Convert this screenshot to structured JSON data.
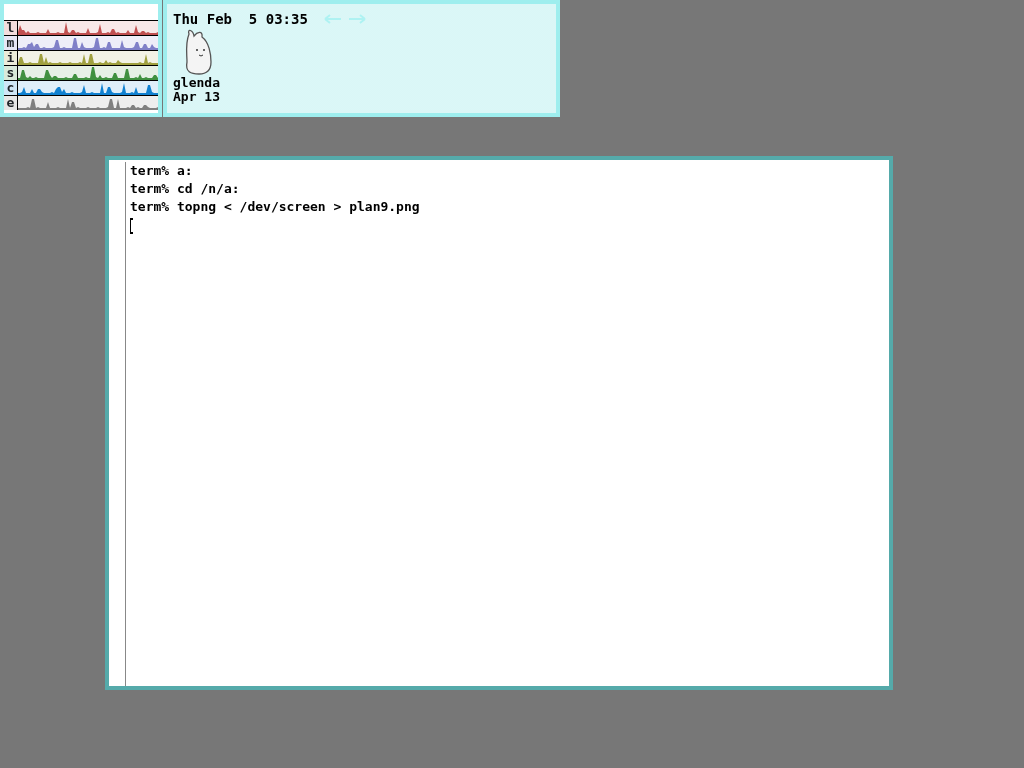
{
  "stats": [
    {
      "label": "l",
      "color": "#c05050"
    },
    {
      "label": "m",
      "color": "#8080c8"
    },
    {
      "label": "i",
      "color": "#a0a040"
    },
    {
      "label": "s",
      "color": "#409040"
    },
    {
      "label": "c",
      "color": "#1080d0"
    },
    {
      "label": "e",
      "color": "#808080"
    }
  ],
  "faces": {
    "date": "Thu Feb  5 03:35",
    "items": [
      {
        "name": "glenda",
        "date": "Apr 13"
      }
    ]
  },
  "terminal": {
    "lines": [
      "term% a:",
      "term% cd /n/a:",
      "term% topng < /dev/screen > plan9.png"
    ]
  }
}
